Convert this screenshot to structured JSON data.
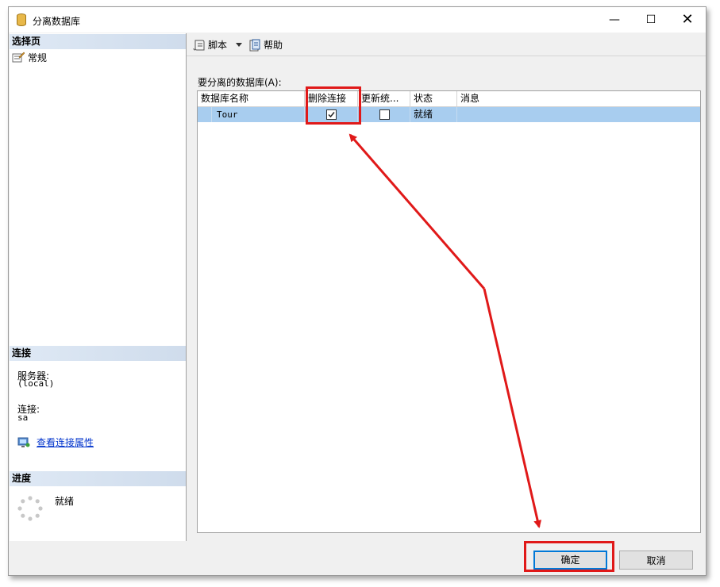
{
  "window": {
    "title": "分离数据库",
    "controls": {
      "minimize": "—",
      "maximize": "☐",
      "close": "✕"
    }
  },
  "left_pane": {
    "select_page": {
      "header": "选择页",
      "items": [
        {
          "label": "常规",
          "icon": "general-page-icon"
        }
      ]
    },
    "connection": {
      "header": "连接",
      "server_label": "服务器:",
      "server_value": "(local)",
      "connection_label": "连接:",
      "connection_value": "sa",
      "view_properties_link": "查看连接属性"
    },
    "progress": {
      "header": "进度",
      "status": "就绪"
    }
  },
  "toolbar": {
    "script_label": "脚本",
    "help_label": "帮助"
  },
  "grid": {
    "label": "要分离的数据库(A):",
    "columns": [
      "数据库名称",
      "删除连接",
      "更新统...",
      "状态",
      "消息"
    ],
    "rows": [
      {
        "name": "Tour",
        "drop_connections": true,
        "update_statistics": false,
        "status": "就绪",
        "message": ""
      }
    ]
  },
  "buttons": {
    "ok": "确定",
    "cancel": "取消"
  },
  "colors": {
    "annotation": "#e01919",
    "selected_row": "#a8cdef",
    "link": "#0033cc",
    "section_header": "#dfe9f5"
  }
}
